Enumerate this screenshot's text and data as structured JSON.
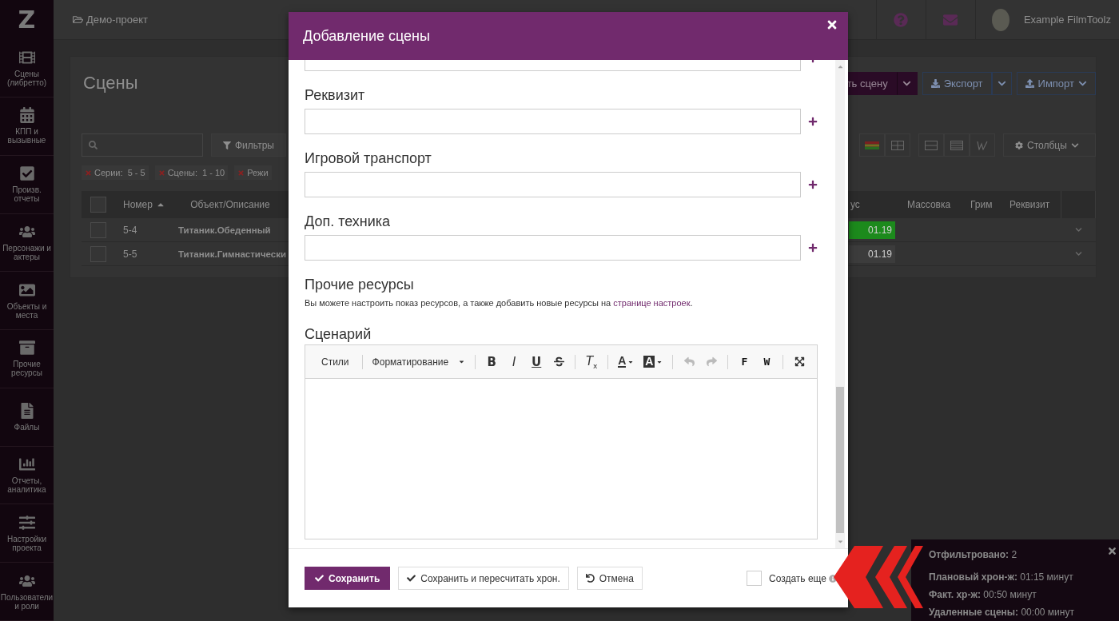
{
  "sidebar": {
    "logo": "Z",
    "items": [
      {
        "label": "Сцены (либретто)"
      },
      {
        "label": "КПП и вызывные"
      },
      {
        "label": "Произв. отчеты"
      },
      {
        "label": "Персонажи и актеры"
      },
      {
        "label": "Объекты и места"
      },
      {
        "label": "Прочие ресурсы"
      },
      {
        "label": "Файлы"
      },
      {
        "label": "Отчеты, аналитика"
      },
      {
        "label": "Настройки проекта"
      },
      {
        "label": "Пользователи и роли"
      }
    ]
  },
  "topbar": {
    "breadcrumb": "Демо-проект",
    "user": "Example FilmToolz"
  },
  "page": {
    "title": "Сцены",
    "add_button": "ть сцену",
    "export_button": "Экспорт",
    "import_button": "Импорт",
    "filters_button": "Фильтры",
    "columns_button": "Столбцы",
    "chips": [
      "Серии:  5 - 5",
      "Сцены:  1 - 10",
      "Режи"
    ]
  },
  "table": {
    "columns": [
      "Номер",
      "Объект/Описание",
      "ус",
      "Массовка",
      "Грим",
      "Реквизит"
    ],
    "select_all": {
      "checked": false
    },
    "rows": [
      {
        "checked": false,
        "number": "5-4",
        "object": "Титаник.Обеденный",
        "status": {
          "text": "01.19",
          "color": "#1c8a1c"
        }
      },
      {
        "checked": false,
        "number": "5-5",
        "object": "Титаник.Гимнастически",
        "status": {
          "text": "01.19",
          "color": "#3c3c3c"
        }
      }
    ]
  },
  "modal": {
    "title": "Добавление сцены",
    "fields": [
      {
        "label": "Реквизит"
      },
      {
        "label": "Игровой транспорт"
      },
      {
        "label": "Доп. техника"
      }
    ],
    "other_resources": {
      "title": "Прочие ресурсы",
      "text": "Вы можете настроить показ ресурсов, а также добавить новые ресурсы на",
      "link": "странице настроек",
      "tail": "."
    },
    "script": {
      "label": "Сценарий",
      "styles": "Стили",
      "format": "Форматирование",
      "glyphs": [
        "B",
        "I",
        "U",
        "T$_{x}$"
      ],
      "colors": [
        "A",
        "A"
      ],
      "history": [
        {
          "disabled": true
        },
        {
          "disabled": true
        }
      ],
      "paste": [
        "F",
        "W"
      ]
    },
    "buttons": [
      {
        "label": "Сохранить",
        "kind": "primary"
      },
      {
        "label": "Сохранить и пересчитать хрон.",
        "kind": "default"
      },
      {
        "label": "Отмена",
        "kind": "cancel"
      }
    ],
    "create_more": {
      "label": "Создать еще",
      "checked": false
    }
  },
  "summary": {
    "lines": [
      "**Отфильтровано:** 2",
      "**Плановый хрон-ж:** 01:15 минут",
      "**Факт. хр-ж:** 00:50 минут",
      "**Удаленные сцены:** 00:00 минут"
    ]
  }
}
